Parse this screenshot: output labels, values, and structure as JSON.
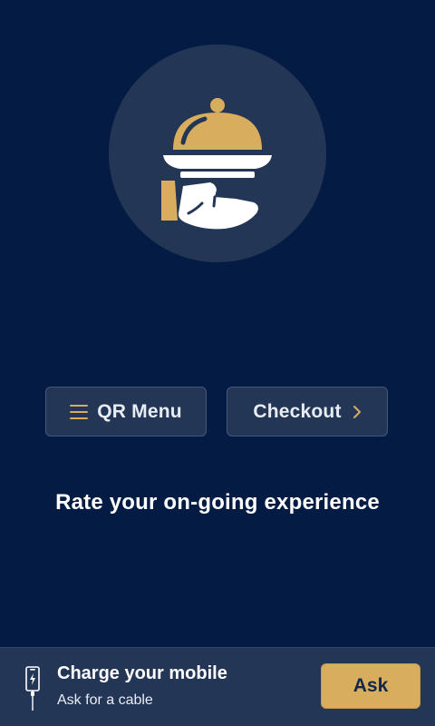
{
  "hero": {
    "icon": "food-service-cloche-hand-icon"
  },
  "actions": {
    "menu_label": "QR Menu",
    "menu_icon": "menu-lines-icon",
    "checkout_label": "Checkout",
    "checkout_icon": "chevron-right-icon"
  },
  "rate_text": "Rate your on-going experience",
  "charge": {
    "icon": "phone-charging-cable-icon",
    "title": "Charge your mobile",
    "subtitle": "Ask for a cable",
    "button_label": "Ask"
  },
  "colors": {
    "background": "#041c44",
    "panel": "#243656",
    "accent": "#d8ad5e",
    "text": "#ffffff"
  }
}
